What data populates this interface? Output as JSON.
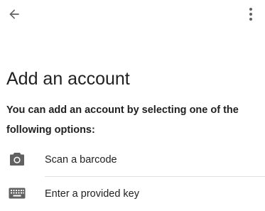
{
  "app_bar": {
    "back_icon": "arrow-back-icon",
    "menu_icon": "more-vert-icon"
  },
  "title": "Add an account",
  "description": "You can add an account by selecting one of the following options:",
  "options": [
    {
      "label": "Scan a barcode",
      "icon": "camera-icon"
    },
    {
      "label": "Enter a provided key",
      "icon": "keyboard-icon"
    }
  ],
  "colors": {
    "text": "#212121",
    "icon": "#616161",
    "divider": "#e0e0e0"
  }
}
